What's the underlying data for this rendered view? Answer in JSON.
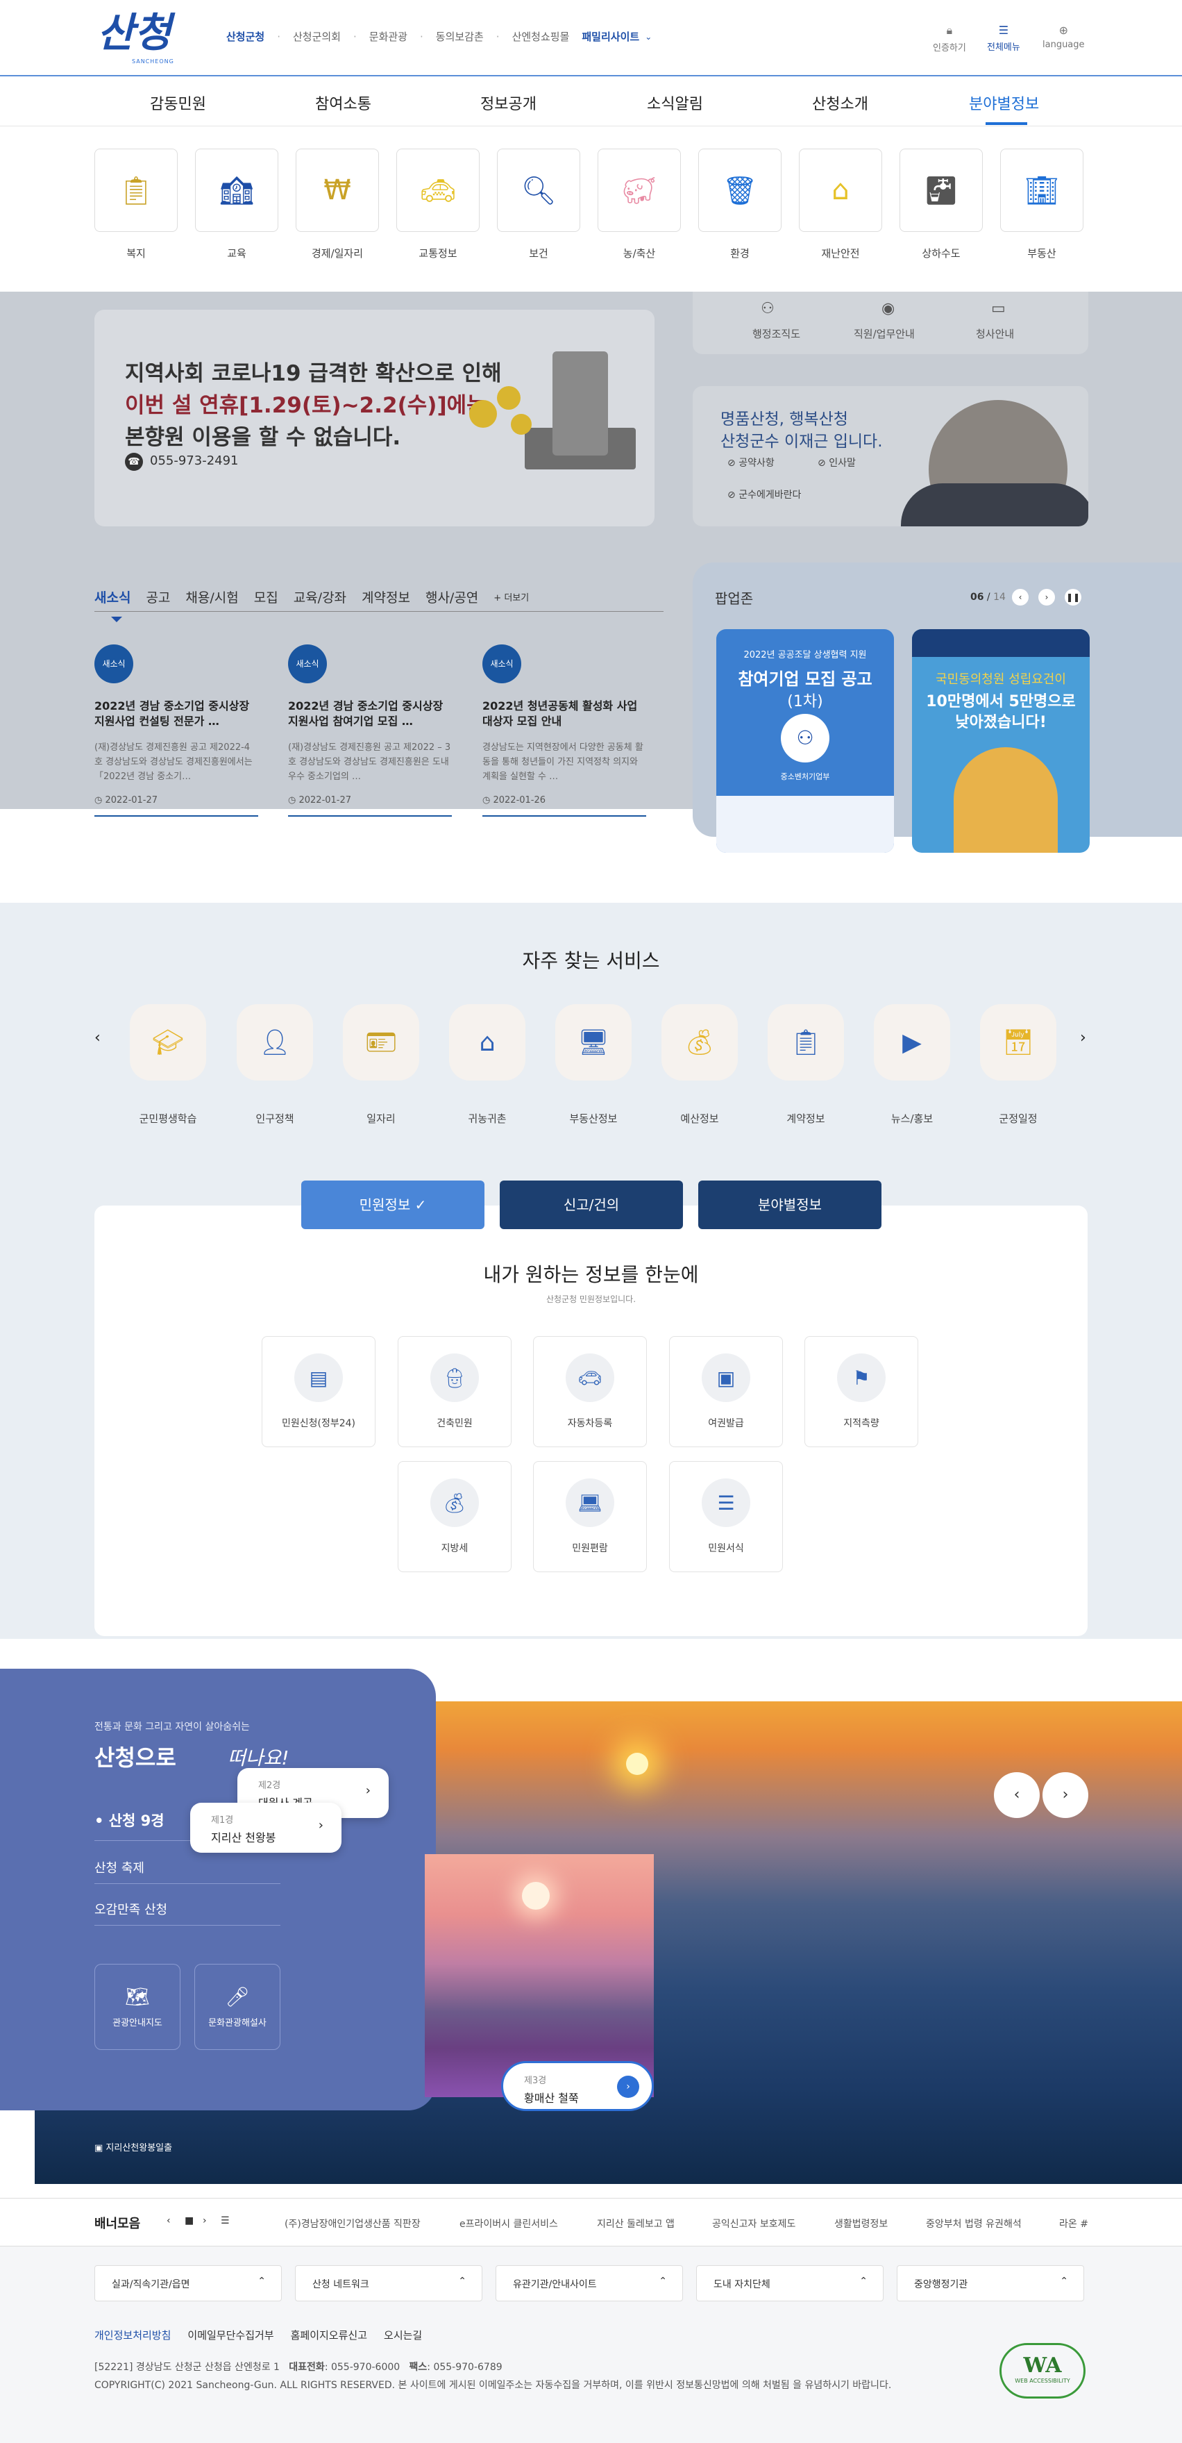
{
  "header": {
    "logo_text": "산청",
    "logo_sub": "SANCHEONG",
    "topnav": [
      "산청군청",
      "산청군의회",
      "문화관광",
      "동의보감촌",
      "산엔청쇼핑몰"
    ],
    "family_site": "패밀리사이트",
    "util": [
      {
        "icon": "lock-icon",
        "label": "인증하기"
      },
      {
        "icon": "menu-icon",
        "label": "전체메뉴"
      },
      {
        "icon": "globe-icon",
        "label": "language"
      }
    ]
  },
  "gnb": [
    "감동민원",
    "참여소통",
    "정보공개",
    "소식알림",
    "산청소개",
    "분야별정보"
  ],
  "sectors": [
    "복지",
    "교육",
    "경제/일자리",
    "교통정보",
    "보건",
    "농/축산",
    "환경",
    "재난안전",
    "상하수도",
    "부동산"
  ],
  "quick_links": [
    "행정조직도",
    "직원/업무안내",
    "청사안내"
  ],
  "covid": {
    "line1": "지역사회 코로나19 급격한 확산으로 인해",
    "line2": "이번 설 연휴[1.29(토)~2.2(수)]에는",
    "line3": "본향원 이용을 할 수 없습니다.",
    "phone": "055-973-2491"
  },
  "mayor": {
    "line1": "명품산청, 행복산청",
    "line2": "산청군수 이재근 입니다.",
    "chips": [
      "공약사항",
      "인사말",
      "군수에게바란다"
    ]
  },
  "news_tabs": [
    "새소식",
    "공고",
    "채용/시험",
    "모집",
    "교육/강좌",
    "계약정보",
    "행사/공연"
  ],
  "more": "+ 더보기",
  "news": [
    {
      "badge": "새소식",
      "title": "2022년 경남 중소기업 중시상장 지원사업 컨설팅 전문가 …",
      "desc": "(재)경상남도 경제진흥원 공고 제2022-4호 경상남도와 경상남도 경제진흥원에서는 「2022년 경남 중소기…",
      "date": "2022-01-27"
    },
    {
      "badge": "새소식",
      "title": "2022년 경남 중소기업 중시상장 지원사업 참여기업 모집 …",
      "desc": "(재)경상남도 경제진흥원 공고 제2022 – 3호 경상남도와 경상남도 경제진흥원은 도내 우수 중소기업의 …",
      "date": "2022-01-27"
    },
    {
      "badge": "새소식",
      "title": "2022년 청년공동체 활성화 사업 대상자 모집 안내",
      "desc": "경상남도는 지역현장에서 다양한 공동체 활동을 통해 청년들이 가진 지역정착 의지와 계획을 실현할 수 …",
      "date": "2022-01-26"
    }
  ],
  "popup": {
    "title": "팝업존",
    "current": "06",
    "total": "14",
    "card1": {
      "top": "2022년 공공조달 상생협력 지원",
      "main": "참여기업 모집 공고",
      "sub": "(1차)",
      "org": "중소벤처기업부"
    },
    "card2": {
      "top": "국민동의청원 성립요건이",
      "main1": "10만명에서 5만명으로",
      "main2": "낮아졌습니다!"
    }
  },
  "frequent": {
    "title": "자주 찾는 서비스",
    "items": [
      {
        "icon": "graduation-cap-icon",
        "label": "군민평생학습"
      },
      {
        "icon": "person-icon",
        "label": "인구정책"
      },
      {
        "icon": "id-card-icon",
        "label": "일자리"
      },
      {
        "icon": "house-icon",
        "label": "귀농귀촌"
      },
      {
        "icon": "monitor-chart-icon",
        "label": "부동산정보"
      },
      {
        "icon": "money-bag-icon",
        "label": "예산정보"
      },
      {
        "icon": "clipboard-icon",
        "label": "계약정보"
      },
      {
        "icon": "play-icon",
        "label": "뉴스/홍보"
      },
      {
        "icon": "calendar-icon",
        "label": "군정일정"
      }
    ]
  },
  "segments": [
    "민원정보",
    "신고/건의",
    "분야별정보"
  ],
  "civil": {
    "title": "내가 원하는 정보를 한눈에",
    "subtitle": "산청군청 민원정보입니다.",
    "items": [
      "민원신청(정부24)",
      "건축민원",
      "자동차등록",
      "여권발급",
      "지적측량",
      "지방세",
      "민원편람",
      "민원서식"
    ]
  },
  "tour": {
    "sub": "전통과 문화 그리고 자연이 살아숨쉬는",
    "title": "산청으로",
    "title2": "떠나요!",
    "menu": [
      "산청 9경",
      "산청 축제",
      "오감만족 산청"
    ],
    "btns": [
      "관광안내지도",
      "문화관광해설사"
    ],
    "bubble1": {
      "num": "제2경",
      "place": "대원사 계곡"
    },
    "bubble2": {
      "num": "제1경",
      "place": "지리산 천왕봉"
    },
    "bubble3": {
      "num": "제3경",
      "place": "황매산 철쭉"
    },
    "caption": "지리산천왕봉일출"
  },
  "banner": {
    "title": "배너모음",
    "links": [
      "(주)경남장애인기업생산품 직판장",
      "e프라이버시 클린서비스",
      "지리산 둘레보고 앱",
      "공익신고자 보호제도",
      "생활법령정보",
      "중앙부처 법령 유권해석",
      "라온 #"
    ]
  },
  "footer": {
    "selects": [
      "실과/직속기관/읍면",
      "산청 네트워크",
      "유관기관/안내사이트",
      "도내 자치단체",
      "중앙행정기관"
    ],
    "links": [
      "개인정보처리방침",
      "이메일무단수집거부",
      "홈페이지오류신고",
      "오시는길"
    ],
    "address": "[52221] 경상남도 산청군 산청읍 산엔청로 1",
    "tel_label": "대표전화",
    "tel": ": 055-970-6000",
    "fax_label": "팩스",
    "fax": ": 055-970-6789",
    "copyright": "COPYRIGHT(C) 2021 Sancheong-Gun. ALL RIGHTS RESERVED. 본 사이트에 게시된 이메일주소는 자동수집을 거부하며, 이를 위반시 정보통신망법에 의해 처벌됨 을 유념하시기 바랍니다.",
    "wa_main": "WA",
    "wa_sub": "WEB ACCESSIBILITY"
  },
  "colors": {
    "accent": "#1e4fa8",
    "active": "#1e6fd6",
    "tour_panel": "#5a6fb0"
  }
}
